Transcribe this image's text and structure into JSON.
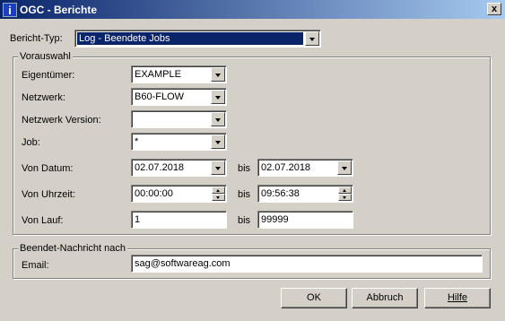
{
  "window": {
    "title": "OGC - Berichte",
    "icon": "info-icon",
    "close_label": "x"
  },
  "report_type": {
    "label": "Bericht-Typ:",
    "value": "Log - Beendete Jobs"
  },
  "preselection": {
    "title": "Vorauswahl",
    "owner": {
      "label": "Eigentümer:",
      "value": "EXAMPLE"
    },
    "network": {
      "label": "Netzwerk:",
      "value": "B60-FLOW"
    },
    "network_version": {
      "label": "Netzwerk Version:",
      "value": ""
    },
    "job": {
      "label": "Job:",
      "value": "*"
    },
    "date": {
      "label": "Von Datum:",
      "from": "02.07.2018",
      "to_label": "bis",
      "to": "02.07.2018"
    },
    "time": {
      "label": "Von Uhrzeit:",
      "from": "00:00:00",
      "to_label": "bis",
      "to": "09:56:38"
    },
    "run": {
      "label": "Von Lauf:",
      "from": "1",
      "to_label": "bis",
      "to": "99999"
    }
  },
  "notify": {
    "title": "Beendet-Nachricht nach",
    "email_label": "Email:",
    "email_value": "sag@softwareag.com"
  },
  "buttons": {
    "ok": "OK",
    "cancel": "Abbruch",
    "help": "Hilfe"
  },
  "colors": {
    "titlebar_start": "#0a246a",
    "titlebar_end": "#a6caf0",
    "dialog_bg": "#d4d0c8",
    "selection": "#0a246a"
  }
}
